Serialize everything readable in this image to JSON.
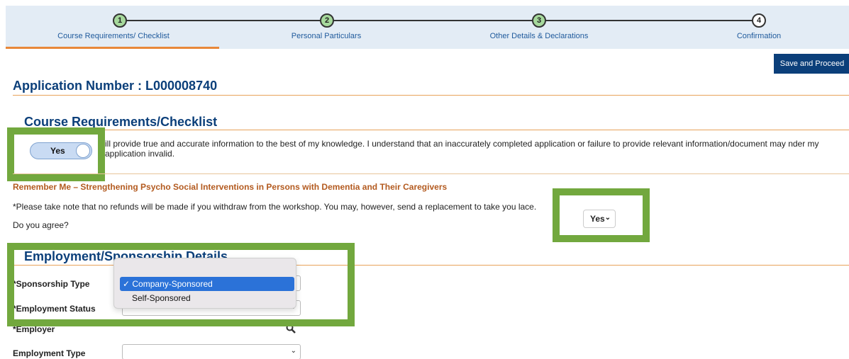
{
  "stepper": {
    "steps": [
      {
        "number": "1",
        "label": "Course Requirements/ Checklist"
      },
      {
        "number": "2",
        "label": "Personal Particulars"
      },
      {
        "number": "3",
        "label": "Other Details & Declarations"
      },
      {
        "number": "4",
        "label": "Confirmation"
      }
    ]
  },
  "toolbar": {
    "save_label": "Save and Proceed"
  },
  "application": {
    "number_label": "Application Number : L000008740"
  },
  "checklist": {
    "title": "Course Requirements/Checklist",
    "toggle_label": "Yes",
    "declaration": "ill provide true and accurate information to the best of my knowledge. I understand that an inaccurately completed application or failure to provide relevant information/document may nder my application invalid."
  },
  "course": {
    "title": "Remember Me – Strengthening Psycho Social Interventions in Persons with Dementia and Their Caregivers",
    "note": "*Please take note that no refunds will be made if you withdraw from the workshop. You may, however, send a replacement to take you lace.",
    "agree_question": "Do you agree?",
    "agree_value": "Yes"
  },
  "employment": {
    "title": "Employment/Sponsorship Details",
    "sponsorship_type_label": "*Sponsorship Type",
    "employment_status_label": "*Employment Status",
    "employer_label": "*Employer",
    "employment_type_label": "Employment Type",
    "sponsorship_options": [
      "Company-Sponsored",
      "Self-Sponsored"
    ],
    "selected_option": "Company-Sponsored"
  },
  "colors": {
    "accent": "#0b3f7a",
    "highlight_box": "#72a83e",
    "divider": "#e8a25a",
    "course_title": "#b35a1f"
  }
}
